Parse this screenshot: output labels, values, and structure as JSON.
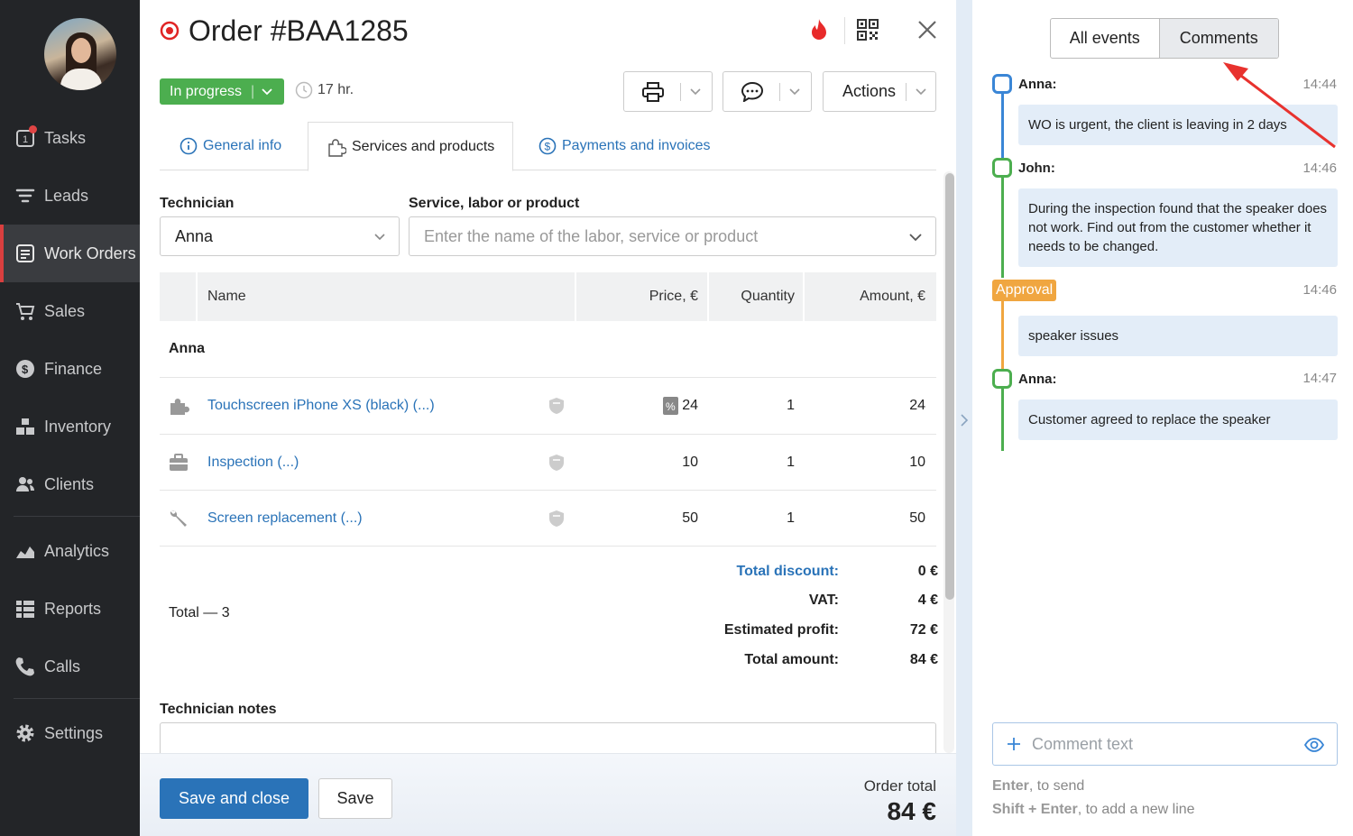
{
  "sidebar": {
    "items": [
      {
        "label": "Tasks",
        "icon": "tasks-icon"
      },
      {
        "label": "Leads",
        "icon": "leads-icon"
      },
      {
        "label": "Work Orders",
        "icon": "work-orders-icon",
        "active": true
      },
      {
        "label": "Sales",
        "icon": "sales-icon"
      },
      {
        "label": "Finance",
        "icon": "finance-icon"
      },
      {
        "label": "Inventory",
        "icon": "inventory-icon"
      },
      {
        "label": "Clients",
        "icon": "clients-icon"
      },
      {
        "label": "Analytics",
        "icon": "analytics-icon"
      },
      {
        "label": "Reports",
        "icon": "reports-icon"
      },
      {
        "label": "Calls",
        "icon": "calls-icon"
      },
      {
        "label": "Settings",
        "icon": "settings-icon"
      }
    ]
  },
  "order": {
    "title": "Order #BAA1285",
    "status": "In progress",
    "elapsed": "17 hr.",
    "actions_label": "Actions"
  },
  "tabs": [
    {
      "label": "General info"
    },
    {
      "label": "Services and products",
      "active": true
    },
    {
      "label": "Payments and invoices"
    }
  ],
  "form": {
    "technician_label": "Technician",
    "technician_value": "Anna",
    "service_label": "Service, labor or product",
    "service_placeholder": "Enter the name of the labor, service or product"
  },
  "table": {
    "headers": {
      "name": "Name",
      "price": "Price, €",
      "quantity": "Quantity",
      "amount": "Amount, €"
    },
    "group": "Anna",
    "rows": [
      {
        "name": "Touchscreen iPhone XS (black) (...)",
        "price": "24",
        "quantity": "1",
        "amount": "24",
        "icon": "product-icon",
        "discount_icon": true
      },
      {
        "name": "Inspection (...)",
        "price": "10",
        "quantity": "1",
        "amount": "10",
        "icon": "briefcase-icon"
      },
      {
        "name": "Screen replacement (...)",
        "price": "50",
        "quantity": "1",
        "amount": "50",
        "icon": "wrench-icon"
      }
    ]
  },
  "totals": {
    "count_label": "Total — 3",
    "discount_label": "Total discount:",
    "discount_value": "0 €",
    "vat_label": "VAT:",
    "vat_value": "4 €",
    "profit_label": "Estimated profit:",
    "profit_value": "72 €",
    "amount_label": "Total amount:",
    "amount_value": "84 €"
  },
  "notes_label": "Technician notes",
  "footer": {
    "save_close": "Save and close",
    "save": "Save",
    "order_total_label": "Order total",
    "order_total_value": "84 €"
  },
  "events_panel": {
    "filters": [
      "All events",
      "Comments"
    ],
    "active_filter": "Comments",
    "events": [
      {
        "author": "Anna:",
        "time": "14:44",
        "text": "WO is urgent, the client is leaving in 2 days",
        "color": "#3a86d6"
      },
      {
        "author": "John:",
        "time": "14:46",
        "text": "During the inspection found that the speaker does not work. Find out from the customer whether it needs to be changed.",
        "color": "#4cae4f"
      },
      {
        "author": "Approval",
        "time": "14:46",
        "text": "speaker issues",
        "color": "#f0a640"
      },
      {
        "author": "Anna:",
        "time": "14:47",
        "text": "Customer agreed to replace the speaker",
        "color": "#4cae4f"
      }
    ],
    "comment_placeholder": "Comment text",
    "hint_send_key": "Enter",
    "hint_send_text": ", to send",
    "hint_newline_key": "Shift + Enter",
    "hint_newline_text": ", to add a new line"
  },
  "colors": {
    "primary": "#2a73b8",
    "success": "#4cae4f",
    "warning": "#f0a640",
    "danger": "#d93f3f",
    "sidebar": "#232528"
  }
}
